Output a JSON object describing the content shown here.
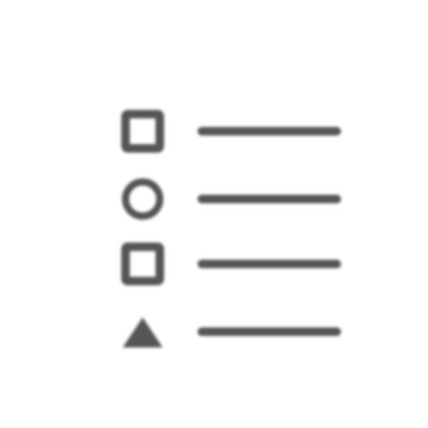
{
  "icon": {
    "name": "bulleted-list-icon",
    "color": "#555555",
    "background": "#ffffff",
    "items": [
      {
        "marker": "square"
      },
      {
        "marker": "circle"
      },
      {
        "marker": "square"
      },
      {
        "marker": "triangle"
      }
    ]
  }
}
